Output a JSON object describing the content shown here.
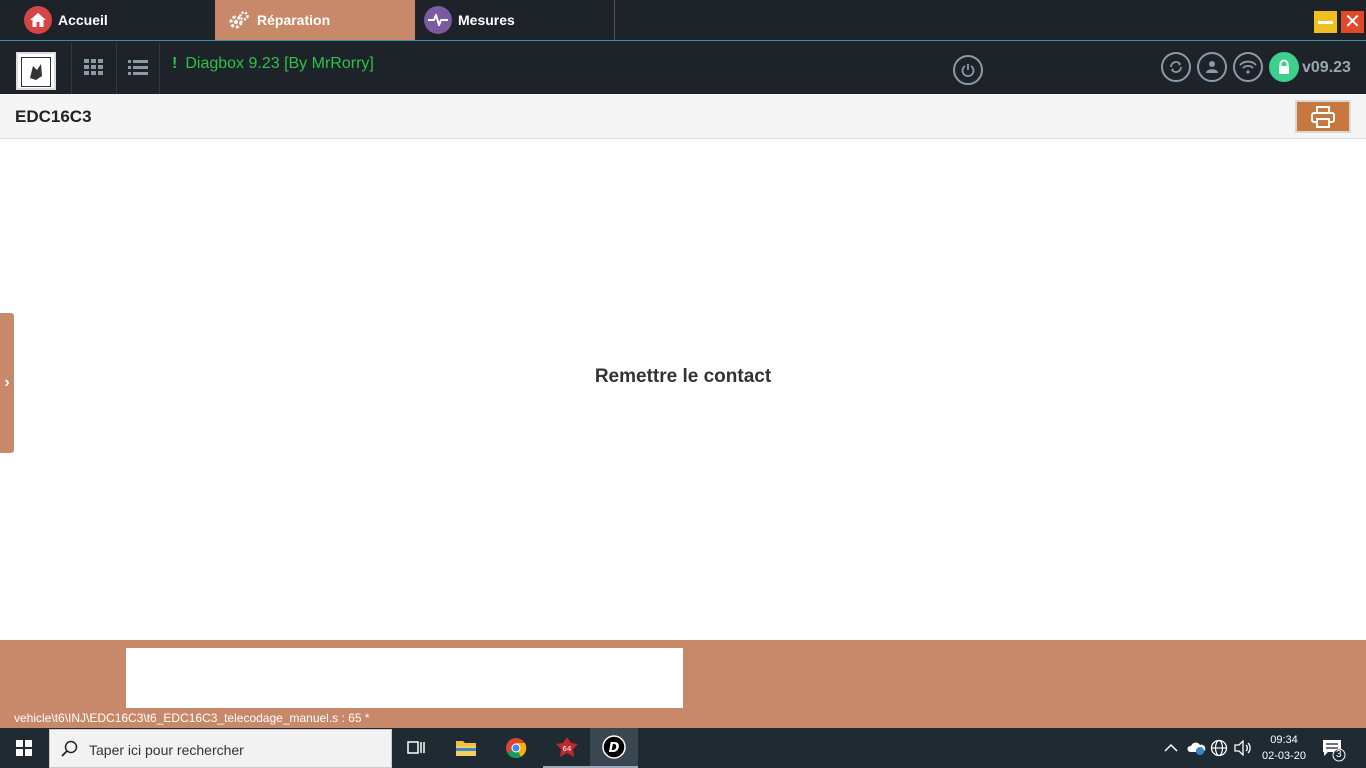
{
  "tabs": [
    {
      "label": "Accueil",
      "icon": "home-icon"
    },
    {
      "label": "Réparation",
      "icon": "gears-icon"
    },
    {
      "label": "Mesures",
      "icon": "waveform-icon"
    }
  ],
  "toolbar": {
    "app_title": "Diagbox 9.23 [By MrRorry]",
    "version": "v09.23",
    "brand_text": "PEUGEOT"
  },
  "header": {
    "ecu_title": "EDC16C3"
  },
  "main": {
    "message": "Remettre le contact"
  },
  "status": {
    "path": "vehicle\\t6\\INJ\\EDC16C3\\t6_EDC16C3_telecodage_manuel.s : 65 *"
  },
  "taskbar": {
    "search_placeholder": "Taper ici pour rechercher",
    "time": "09:34",
    "date": "02-03-20",
    "notification_count": "3"
  },
  "colors": {
    "accent": "#c8896a",
    "dark": "#1d2329",
    "green": "#2bc24a",
    "lock": "#3ccf8e"
  }
}
